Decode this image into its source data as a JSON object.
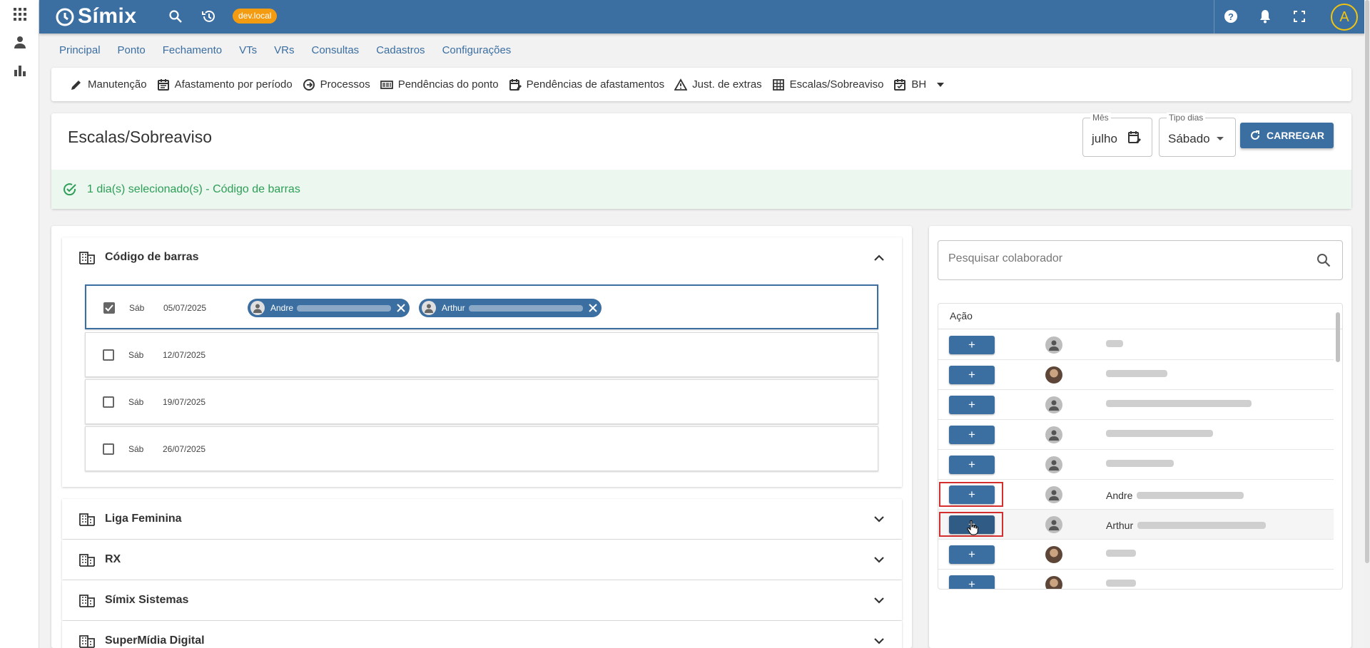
{
  "app": {
    "name": "Símix",
    "env_badge": "dev.local",
    "user_initial": "A"
  },
  "menu": [
    "Principal",
    "Ponto",
    "Fechamento",
    "VTs",
    "VRs",
    "Consultas",
    "Cadastros",
    "Configurações"
  ],
  "actions": [
    {
      "label": "Manutenção",
      "icon": "pencil-icon"
    },
    {
      "label": "Afastamento por período",
      "icon": "calendar-icon"
    },
    {
      "label": "Processos",
      "icon": "process-icon"
    },
    {
      "label": "Pendências do ponto",
      "icon": "barcode-icon"
    },
    {
      "label": "Pendências de afastamentos",
      "icon": "calendar-edit-icon"
    },
    {
      "label": "Just. de extras",
      "icon": "warning-icon"
    },
    {
      "label": "Escalas/Sobreaviso",
      "icon": "grid-icon"
    },
    {
      "label": "BH",
      "icon": "calendar-check-icon"
    }
  ],
  "page": {
    "title": "Escalas/Sobreaviso",
    "month_label": "Mês",
    "month_value": "julho",
    "type_label": "Tipo dias",
    "type_value": "Sábado",
    "load_button": "CARREGAR",
    "alert": "1 dia(s) selecionado(s) - Código de barras"
  },
  "groups": [
    {
      "name": "Código de barras",
      "expanded": true
    },
    {
      "name": "Liga Feminina",
      "expanded": false
    },
    {
      "name": "RX",
      "expanded": false
    },
    {
      "name": "Símix Sistemas",
      "expanded": false
    },
    {
      "name": "SuperMídia Digital",
      "expanded": false
    }
  ],
  "days": [
    {
      "dow": "Sáb",
      "date": "05/07/2025",
      "checked": true,
      "chips": [
        "Andre",
        "Arthur"
      ]
    },
    {
      "dow": "Sáb",
      "date": "12/07/2025",
      "checked": false,
      "chips": []
    },
    {
      "dow": "Sáb",
      "date": "19/07/2025",
      "checked": false,
      "chips": []
    },
    {
      "dow": "Sáb",
      "date": "26/07/2025",
      "checked": false,
      "chips": []
    }
  ],
  "collaborators": {
    "search_placeholder": "Pesquisar colaborador",
    "column_action": "Ação",
    "add_label": "+",
    "rows": [
      {
        "name": "",
        "avatar": "default"
      },
      {
        "name": "",
        "avatar": "photo"
      },
      {
        "name": "",
        "avatar": "default"
      },
      {
        "name": "",
        "avatar": "default"
      },
      {
        "name": "",
        "avatar": "default"
      },
      {
        "name": "Andre",
        "avatar": "default",
        "highlighted": true
      },
      {
        "name": "Arthur",
        "avatar": "default",
        "highlighted": true,
        "hover": true
      },
      {
        "name": "",
        "avatar": "photo"
      },
      {
        "name": "",
        "avatar": "photo"
      }
    ]
  },
  "colors": {
    "primary": "#3b6ea1",
    "success": "#2e9e57",
    "badge": "#f39c12",
    "highlight": "#d32f2f"
  }
}
